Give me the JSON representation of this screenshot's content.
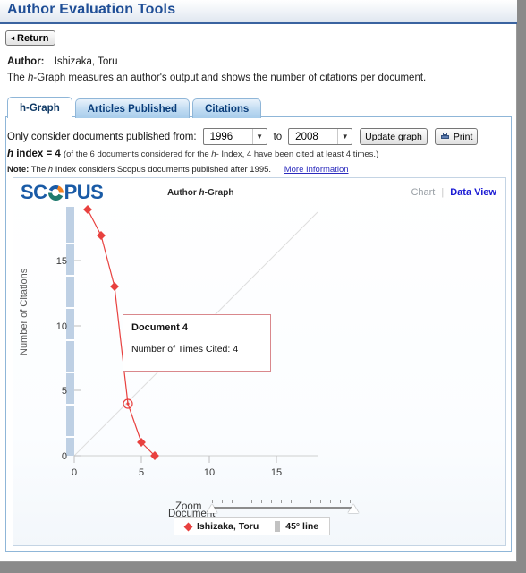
{
  "header": {
    "title": "Author Evaluation Tools",
    "return_label": "Return",
    "return_arrow": "◂"
  },
  "author": {
    "label": "Author:",
    "name": "Ishizaka, Toru",
    "description_pre": "The ",
    "description_em": "h",
    "description_post": "-Graph measures an author's output and shows the number of citations per document."
  },
  "tabs": [
    {
      "label": "h-Graph",
      "active": true
    },
    {
      "label": "Articles Published",
      "active": false
    },
    {
      "label": "Citations",
      "active": false
    }
  ],
  "filters": {
    "prompt": "Only consider documents published from:",
    "from_value": "1996",
    "to_label": "to",
    "to_value": "2008",
    "update_label": "Update graph",
    "print_label": "Print",
    "caret": "▼"
  },
  "hindex": {
    "label_pre": "h",
    "label_post": " index",
    "equals": " = ",
    "value": "4",
    "detail_pre": "(of the 6 documents considered for the ",
    "detail_em": "h",
    "detail_post": "- Index, 4 have been cited at least 4 times.)"
  },
  "note": {
    "label": "Note:",
    "text_pre": "The ",
    "text_em": "h",
    "text_post": " Index considers Scopus documents published after 1995.",
    "link": "More Information"
  },
  "chart_header": {
    "logo_s1": "SC",
    "logo_s2": "PUS",
    "subtitle_pre": "Author ",
    "subtitle_em": "h",
    "subtitle_post": "-Graph",
    "view_chart": "Chart",
    "view_divider": "|",
    "view_data": "Data View"
  },
  "tooltip": {
    "line1": "Document 4",
    "line2_label": "Number of Times Cited:",
    "line2_value": "4"
  },
  "zoom": {
    "label": "Zoom"
  },
  "legend": {
    "series_label": "Ishizaka, Toru",
    "reference_label": "45° line"
  },
  "chart_data": {
    "type": "line",
    "title": "Author h-Graph",
    "xlabel": "Document",
    "ylabel": "Number of Citations",
    "xlim": [
      0,
      18
    ],
    "ylim": [
      0,
      19
    ],
    "xticks": [
      0,
      5,
      10,
      15
    ],
    "yticks": [
      0,
      5,
      10,
      15
    ],
    "grid": false,
    "legend_position": "bottom",
    "series": [
      {
        "name": "Ishizaka, Toru",
        "color": "#e8413f",
        "marker": "diamond",
        "x": [
          1,
          2,
          3,
          4,
          5,
          6
        ],
        "values": [
          19,
          17,
          13,
          4,
          1,
          0
        ]
      },
      {
        "name": "45° line",
        "color": "#d7d7d7",
        "marker": "none",
        "x": [
          0,
          18
        ],
        "values": [
          0,
          18
        ]
      }
    ],
    "highlighted_point": {
      "x": 4,
      "y": 4,
      "label": "Document 4",
      "cited": 4
    }
  },
  "colors": {
    "title_blue": "#1f4e96",
    "tab_active_bg": "#ffffff",
    "tab_inactive_bg": "#bcd9f1",
    "series_red": "#e8413f",
    "link_blue": "#2b2bbd",
    "scopus_blue": "#1a5ba6"
  }
}
